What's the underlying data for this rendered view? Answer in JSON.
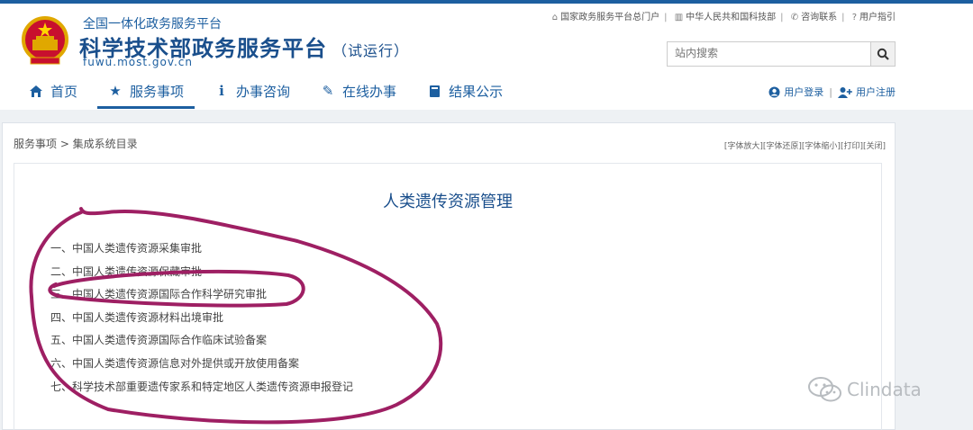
{
  "header": {
    "subtitle": "全国一体化政务服务平台",
    "title": "科学技术部政务服务平台",
    "title_note": "（试运行）",
    "domain": "fuwu.most.gov.cn"
  },
  "top_links": [
    {
      "label": "国家政务服务平台总门户",
      "icon": "home-icon"
    },
    {
      "label": "中华人民共和国科技部",
      "icon": "bank-icon"
    },
    {
      "label": "咨询联系",
      "icon": "phone-icon"
    },
    {
      "label": "用户指引",
      "icon": "question-icon"
    }
  ],
  "search": {
    "placeholder": "站内搜索"
  },
  "nav": [
    {
      "label": "首页",
      "icon": "home-icon"
    },
    {
      "label": "服务事项",
      "icon": "star-icon"
    },
    {
      "label": "办事咨询",
      "icon": "info-icon"
    },
    {
      "label": "在线办事",
      "icon": "pencil-icon"
    },
    {
      "label": "结果公示",
      "icon": "book-icon"
    }
  ],
  "user": {
    "login": "用户登录",
    "register": "用户注册"
  },
  "breadcrumb": "服务事项 > 集成系统目录",
  "tools": "[字体放大][字体还原][字体缩小][打印][关闭]",
  "page_title": "人类遗传资源管理",
  "items": [
    "一、中国人类遗传资源采集审批",
    "二、中国人类遗传资源保藏审批",
    "三、中国人类遗传资源国际合作科学研究审批",
    "四、中国人类遗传资源材料出境审批",
    "五、中国人类遗传资源国际合作临床试验备案",
    "六、中国人类遗传资源信息对外提供或开放使用备案",
    "七、科学技术部重要遗传家系和特定地区人类遗传资源申报登记"
  ],
  "watermark": "Clindata",
  "colors": {
    "brand": "#1d5fa0",
    "annotation": "#9e1f63"
  }
}
